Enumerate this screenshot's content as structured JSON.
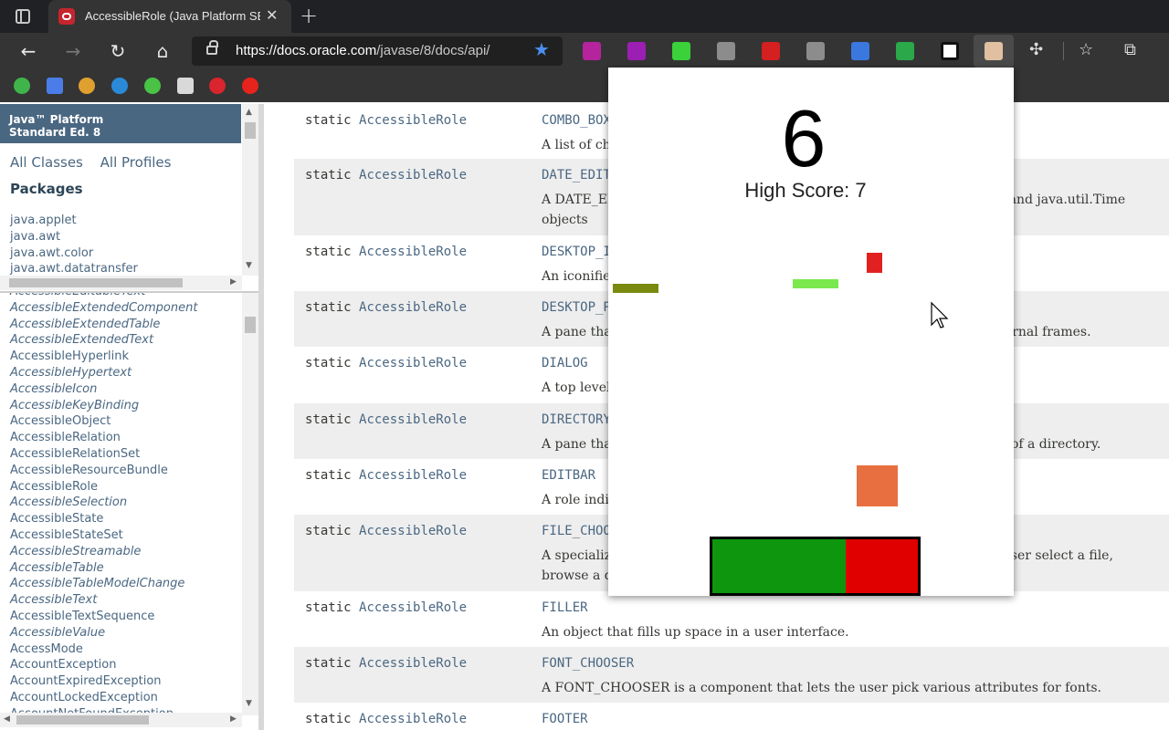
{
  "browser": {
    "tab": {
      "title": "AccessibleRole (Java Platform SE",
      "close": "✕",
      "new_tab": "+"
    },
    "address": {
      "url_host": "https://docs.oracle.com",
      "url_path": "/javase/8/docs/api/"
    },
    "nav": {
      "back": "←",
      "forward": "→",
      "reload": "↻",
      "home": "⌂"
    },
    "extension_colors": [
      "#b5249c",
      "#9b1fb3",
      "#3ad13a",
      "#8c8c8c",
      "#d42020",
      "#8c8c8c",
      "#3a78e0",
      "#2aa84a",
      "#ffffff",
      "#e0c0a0"
    ],
    "bookmark_colors": [
      "#3fb44a",
      "#4a7de8",
      "#e0a030",
      "#2a8ad8",
      "#49c245",
      "#d9d9d9",
      "#d9252e",
      "#e6241c"
    ]
  },
  "sidebar": {
    "title": "Java™ Platform\nStandard Ed. 8",
    "links": [
      "All Classes",
      "All Profiles"
    ],
    "packages_heading": "Packages",
    "packages": [
      "java.applet",
      "java.awt",
      "java.awt.color",
      "java.awt.datatransfer"
    ],
    "classes": [
      {
        "name": "AccessibleEditableText",
        "italic": true
      },
      {
        "name": "AccessibleExtendedComponent",
        "italic": true
      },
      {
        "name": "AccessibleExtendedTable",
        "italic": true
      },
      {
        "name": "AccessibleExtendedText",
        "italic": true
      },
      {
        "name": "AccessibleHyperlink",
        "italic": false
      },
      {
        "name": "AccessibleHypertext",
        "italic": true
      },
      {
        "name": "AccessibleIcon",
        "italic": true
      },
      {
        "name": "AccessibleKeyBinding",
        "italic": true
      },
      {
        "name": "AccessibleObject",
        "italic": false
      },
      {
        "name": "AccessibleRelation",
        "italic": false
      },
      {
        "name": "AccessibleRelationSet",
        "italic": false
      },
      {
        "name": "AccessibleResourceBundle",
        "italic": false
      },
      {
        "name": "AccessibleRole",
        "italic": false
      },
      {
        "name": "AccessibleSelection",
        "italic": true
      },
      {
        "name": "AccessibleState",
        "italic": false
      },
      {
        "name": "AccessibleStateSet",
        "italic": false
      },
      {
        "name": "AccessibleStreamable",
        "italic": true
      },
      {
        "name": "AccessibleTable",
        "italic": true
      },
      {
        "name": "AccessibleTableModelChange",
        "italic": true
      },
      {
        "name": "AccessibleText",
        "italic": true
      },
      {
        "name": "AccessibleTextSequence",
        "italic": false
      },
      {
        "name": "AccessibleValue",
        "italic": true
      },
      {
        "name": "AccessMode",
        "italic": false
      },
      {
        "name": "AccountException",
        "italic": false
      },
      {
        "name": "AccountExpiredException",
        "italic": false
      },
      {
        "name": "AccountLockedException",
        "italic": false
      },
      {
        "name": "AccountNotFoundException",
        "italic": false
      }
    ]
  },
  "fields": [
    {
      "modifier": "static",
      "type": "AccessibleRole",
      "name": "COMBO_BOX",
      "desc": [
        "A list of choices the user can select from."
      ]
    },
    {
      "modifier": "static",
      "type": "AccessibleRole",
      "name": "DATE_EDITOR",
      "desc": [
        "A DATE_EDITOR is a component that allows users to edit java.util.Date and java.util.Time",
        "objects"
      ]
    },
    {
      "modifier": "static",
      "type": "AccessibleRole",
      "name": "DESKTOP_ICON",
      "desc": [
        "An iconified internal frame in a DESKTOP_PANE."
      ]
    },
    {
      "modifier": "static",
      "type": "AccessibleRole",
      "name": "DESKTOP_PANE",
      "desc": [
        "A pane that supports internal frames and iconified versions of those internal frames."
      ]
    },
    {
      "modifier": "static",
      "type": "AccessibleRole",
      "name": "DIALOG",
      "desc": [
        "A top level window with title bar and a border."
      ]
    },
    {
      "modifier": "static",
      "type": "AccessibleRole",
      "name": "DIRECTORY_PANE",
      "desc": [
        "A pane that allows the user to navigate through and select the contents of a directory."
      ]
    },
    {
      "modifier": "static",
      "type": "AccessibleRole",
      "name": "EDITBAR",
      "desc": [
        "A role indicating the object acts as a formula for calculating a value."
      ]
    },
    {
      "modifier": "static",
      "type": "AccessibleRole",
      "name": "FILE_CHOOSER",
      "desc": [
        "A specialized dialog that displays the files in the directory and lets the user select a file,",
        "browse a different directory, or specify a filename."
      ]
    },
    {
      "modifier": "static",
      "type": "AccessibleRole",
      "name": "FILLER",
      "desc": [
        "An object that fills up space in a user interface."
      ]
    },
    {
      "modifier": "static",
      "type": "AccessibleRole",
      "name": "FONT_CHOOSER",
      "desc": [
        "A FONT_CHOOSER is a component that lets the user pick various attributes for fonts."
      ]
    },
    {
      "modifier": "static",
      "type": "AccessibleRole",
      "name": "FOOTER",
      "desc": [
        ""
      ]
    }
  ],
  "game": {
    "score": "6",
    "high_score_label": "High Score: 7",
    "player_health_fraction": 0.65,
    "colors": {
      "good": "#0e970e",
      "bad": "#e00000"
    }
  }
}
